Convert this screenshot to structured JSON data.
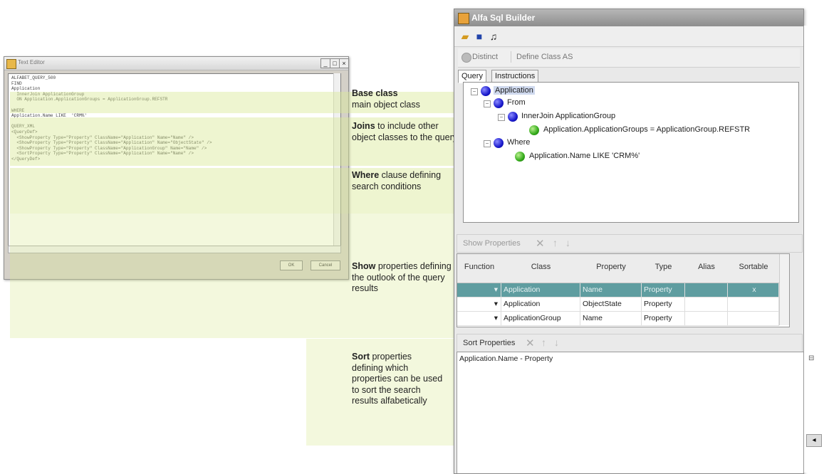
{
  "text_editor": {
    "title": "Text Editor",
    "code": "ALFABET_QUERY_500\nFIND\nApplication\n  InnerJoin ApplicationGroup\n  ON Application.ApplicationGroups = ApplicationGroup.REFSTR\n\nWHERE\nApplication.Name LIKE  'CRM%'\n\nQUERY_XML\n<QueryDef>\n  <ShowProperty Type=\"Property\" ClassName=\"Application\" Name=\"Name\" />\n  <ShowProperty Type=\"Property\" ClassName=\"Application\" Name=\"ObjectState\" />\n  <ShowProperty Type=\"Property\" ClassName=\"ApplicationGroup\" Name=\"Name\" />\n  <SortProperty Type=\"Property\" ClassName=\"Application\" Name=\"Name\" />\n</QueryDef>",
    "ok_label": "OK",
    "cancel_label": "Cancel",
    "controls": [
      "_",
      "□",
      "×"
    ]
  },
  "annotations": [
    {
      "bold": "Base class",
      "text": "main object class"
    },
    {
      "bold": "Joins",
      "text": " to include other object classes to the query"
    },
    {
      "bold": "Where",
      "text": " clause defining search conditions"
    },
    {
      "bold": "Show",
      "text": " properties defining the outlook of the query results"
    },
    {
      "bold": "Sort",
      "text": " properties defining which properties can be used to sort the search results alfabetically"
    }
  ],
  "builder": {
    "title": "Alfa Sql Builder",
    "toolbar_icons": [
      "open-folder-icon",
      "save-icon",
      "bell-icon"
    ],
    "distinct_label": "Distinct",
    "define_class_label": "Define Class AS",
    "tabs": [
      "Query",
      "Instructions"
    ],
    "tree": {
      "root": "Application",
      "from": "From",
      "join": "InnerJoin  ApplicationGroup",
      "join_condition": "Application.ApplicationGroups = ApplicationGroup.REFSTR",
      "where": "Where",
      "where_condition": "Application.Name LIKE  'CRM%'"
    },
    "show_properties": {
      "toolbar_label": "Show Properties",
      "columns": [
        "Function",
        "Class",
        "Property",
        "Type",
        "Alias",
        "Sortable"
      ],
      "rows": [
        {
          "class": "Application",
          "property": "Name",
          "type": "Property",
          "alias": "",
          "sortable": "x"
        },
        {
          "class": "Application",
          "property": "ObjectState",
          "type": "Property",
          "alias": "",
          "sortable": ""
        },
        {
          "class": "ApplicationGroup",
          "property": "Name",
          "type": "Property",
          "alias": "",
          "sortable": ""
        }
      ]
    },
    "sort_properties": {
      "toolbar_label": "Sort Properties",
      "items": [
        "Application.Name - Property"
      ]
    }
  },
  "colors": {
    "highlight": "#dae896",
    "selected_row": "#5f9da0",
    "title_bar": "#9a9a9a"
  }
}
